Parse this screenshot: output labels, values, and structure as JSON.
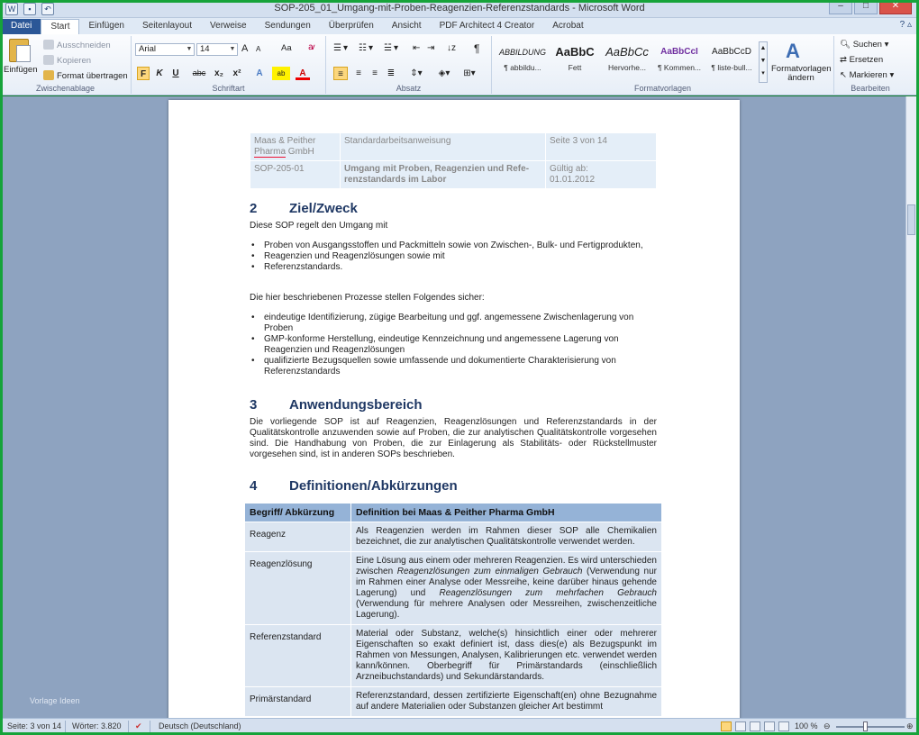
{
  "window": {
    "title": "SOP-205_01_Umgang-mit-Proben-Reagenzien-Referenzstandards - Microsoft Word"
  },
  "tabs": [
    "Datei",
    "Start",
    "Einfügen",
    "Seitenlayout",
    "Verweise",
    "Sendungen",
    "Überprüfen",
    "Ansicht",
    "PDF Architect 4 Creator",
    "Acrobat"
  ],
  "ribbon": {
    "clipboard": {
      "paste": "Einfügen",
      "cut": "Ausschneiden",
      "copy": "Kopieren",
      "format_painter": "Format übertragen",
      "label": "Zwischenablage"
    },
    "font": {
      "font_name": "Arial",
      "font_size": "14",
      "grow": "A",
      "shrink": "A",
      "case": "Aa",
      "clear": "ꜹ",
      "bold": "F",
      "italic": "K",
      "underline": "U",
      "strike": "abc",
      "subscript": "x₂",
      "superscript": "x²",
      "label": "Schriftart"
    },
    "paragraph": {
      "label": "Absatz"
    },
    "styles": {
      "items": [
        {
          "sample": "ABBILDUNG",
          "name": "¶ abbildu..."
        },
        {
          "sample": "AaBbC",
          "name": "Fett"
        },
        {
          "sample": "AaBbCc",
          "name": "Hervorhe..."
        },
        {
          "sample": "AaBbCcI",
          "name": "¶ Kommen..."
        },
        {
          "sample": "AaBbCcD",
          "name": "¶ liste-bull..."
        }
      ],
      "change": "Formatvorlagen ändern",
      "label": "Formatvorlagen"
    },
    "editing": {
      "find": "Suchen",
      "replace": "Ersetzen",
      "select": "Markieren",
      "label": "Bearbeiten"
    }
  },
  "document": {
    "header": {
      "company_a": "Maas & Peither",
      "company_b": "Pharma",
      "company_c": " GmbH",
      "doc_type": "Standardarbeitsanweisung",
      "page": "Seite 3 von 14",
      "sop_id": "SOP-205-01",
      "sop_title": "Umgang mit Proben, Reagenzien und Refe-renzstandards im Labor",
      "valid_label": "Gültig ab:",
      "valid_date": "01.01.2012"
    },
    "s2": {
      "num": "2",
      "title": "Ziel/Zweck",
      "intro": "Diese SOP regelt den Umgang mit",
      "bullets1": [
        "Proben von Ausgangsstoffen und Packmitteln sowie von Zwischen-, Bulk- und Fertigprodukten,",
        "Reagenzien und Reagenzlösungen sowie mit",
        "Referenzstandards."
      ],
      "intro2": "Die hier beschriebenen Prozesse stellen Folgendes sicher:",
      "bullets2": [
        "eindeutige Identifizierung, zügige Bearbeitung und ggf. angemessene Zwischenlagerung von Proben",
        "GMP-konforme Herstellung, eindeutige Kennzeichnung und angemessene Lagerung von Reagenzien und Reagenzlösungen",
        "qualifizierte Bezugsquellen sowie umfassende und dokumentierte Charakterisierung von Referenzstandards"
      ]
    },
    "s3": {
      "num": "3",
      "title": "Anwendungsbereich",
      "text": "Die vorliegende SOP ist auf Reagenzien, Reagenzlösungen und Referenzstandards in der Qualitätskontrolle anzuwenden sowie auf Proben, die zur analytischen Qualitätskontrolle vorgesehen sind. Die Handhabung von Proben, die zur Einlagerung als Stabilitäts- oder Rückstellmuster vorgesehen sind, ist in anderen SOPs beschrieben."
    },
    "s4": {
      "num": "4",
      "title": "Definitionen/Abkürzungen",
      "col1": "Begriff/ Abkürzung",
      "col2": "Definition bei Maas & Peither Pharma GmbH",
      "rows": [
        {
          "term": "Reagenz",
          "def": "Als Reagenzien werden im Rahmen dieser SOP alle Chemikalien bezeichnet, die zur analytischen Qualitätskontrolle verwendet werden."
        },
        {
          "term": "Reagenzlösung",
          "def_a": "Eine Lösung aus einem oder mehreren Reagenzien. Es wird unterschieden zwischen ",
          "def_i1": "Reagenzlösungen zum einmaligen Gebrauch",
          "def_b": " (Verwendung nur im Rahmen einer Analyse oder Messreihe, keine darüber hinaus gehende Lagerung) und ",
          "def_i2": "Reagenzlösungen zum mehrfachen Gebrauch",
          "def_c": " (Verwendung für mehrere Analysen oder Messreihen, zwischenzeitliche Lagerung)."
        },
        {
          "term": "Referenzstandard",
          "def": "Material oder Substanz, welche(s) hinsichtlich einer oder mehrerer Eigenschaften so exakt definiert ist, dass dies(e) als Bezugspunkt im Rahmen von Messungen, Analysen, Kalibrierungen etc. verwendet werden kann/können. Oberbegriff für Primärstandards (einschließlich Arzneibuchstandards) und Sekundärstandards."
        },
        {
          "term": "Primärstandard",
          "def": "Referenzstandard, dessen zertifizierte Eigenschaft(en) ohne Bezugnahme auf andere Materialien oder Substanzen gleicher Art bestimmt"
        }
      ]
    }
  },
  "watermark": "Vorlage Ideen",
  "status": {
    "page": "Seite: 3 von 14",
    "words": "Wörter: 3.820",
    "language": "Deutsch (Deutschland)",
    "zoom": "100 %"
  }
}
